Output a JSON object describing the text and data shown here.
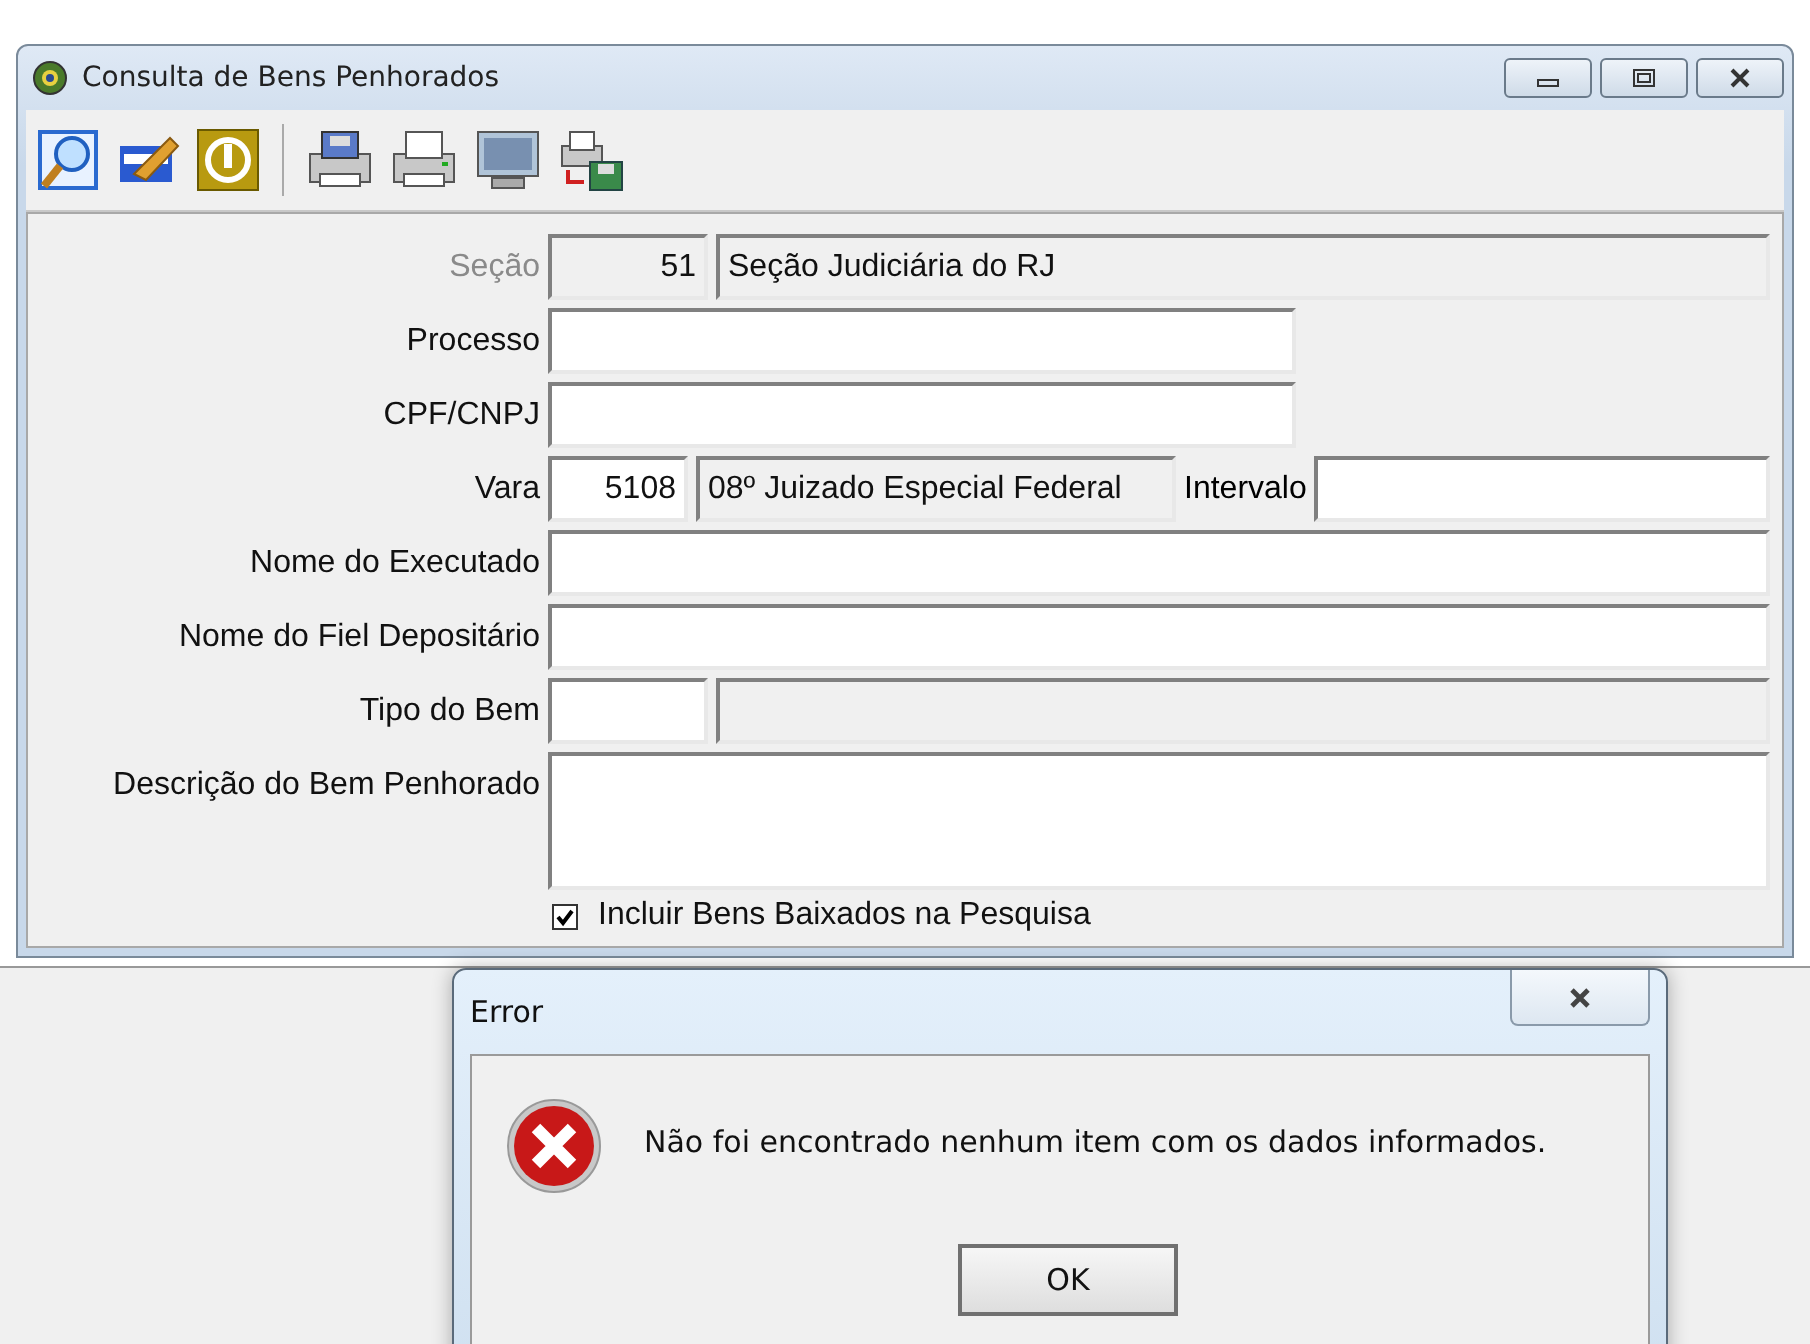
{
  "window": {
    "title": "Consulta de Bens Penhorados"
  },
  "form": {
    "rows": [
      {
        "kind": "code_desc",
        "label": "Seção",
        "disabled": true,
        "code": "51",
        "description": "Seção Judiciária do RJ"
      },
      {
        "kind": "short",
        "label": "Processo",
        "disabled": false
      },
      {
        "kind": "short",
        "label": "CPF/CNPJ",
        "disabled": false
      },
      {
        "kind": "code_interval",
        "label": "Vara",
        "disabled": false,
        "code": "5108",
        "description": "08º Juizado Especial Federal",
        "interval_label": "Intervalo"
      },
      {
        "kind": "wide",
        "label": "Nome do Executado",
        "disabled": false
      },
      {
        "kind": "wide",
        "label": "Nome do Fiel Depositário",
        "disabled": false
      },
      {
        "kind": "code_desc",
        "label": "Tipo do Bem",
        "disabled": false
      },
      {
        "kind": "memo",
        "label": "Descrição do Bem Penhorado",
        "disabled": false
      }
    ],
    "checkbox": {
      "label": "Incluir Bens Baixados na Pesquisa",
      "checked": true
    }
  },
  "dialog": {
    "title": "Error",
    "message": "Não foi encontrado nenhum item com os dados informados.",
    "button": "OK"
  }
}
